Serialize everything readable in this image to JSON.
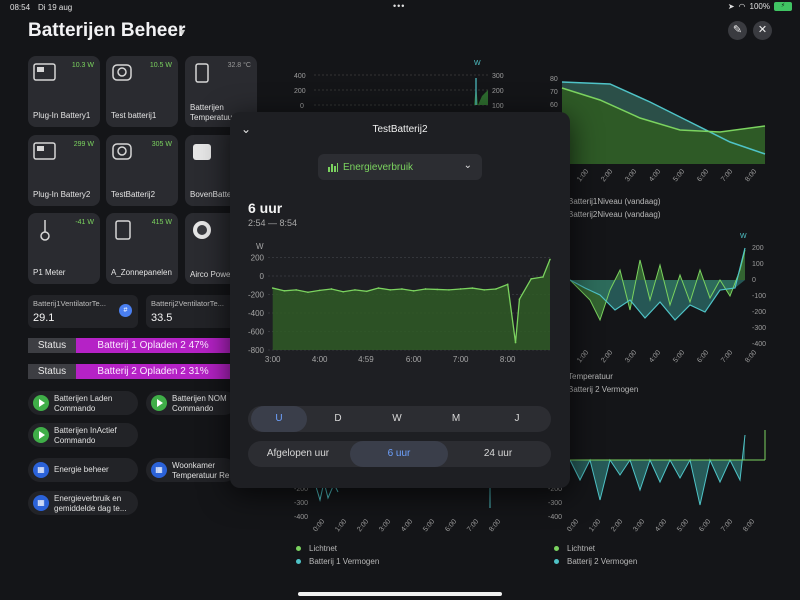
{
  "status_bar": {
    "time": "08:54",
    "date": "Di 19 aug",
    "battery": "100%"
  },
  "header": {
    "title": "Batterijen Beheer"
  },
  "tiles": [
    {
      "label": "Plug-In Battery1",
      "power": "10.3 W"
    },
    {
      "label": "Test batterij1",
      "power": "10.5 W"
    },
    {
      "label": "Batterijen Temperatuur",
      "power": "32.8 °C"
    },
    {
      "label": "Plug-In Battery2",
      "power": "299 W"
    },
    {
      "label": "TestBatterij2",
      "power": "305 W"
    },
    {
      "label": "BovenBatte",
      "power": "3"
    },
    {
      "label": "P1 Meter",
      "power": "-41 W"
    },
    {
      "label": "A_Zonnepanelen",
      "power": "415 W"
    },
    {
      "label": "Airco Power Plug",
      "power": ""
    }
  ],
  "sensors": [
    {
      "name": "Batterij1VentilatorTe...",
      "value": "29.1",
      "badge": "#"
    },
    {
      "name": "Batterij2VentilatorTe...",
      "value": "33.5"
    }
  ],
  "statuses": [
    {
      "key": "Status",
      "value": "Batterij 1 Opladen 2 47%"
    },
    {
      "key": "Status",
      "value": "Batterij 2 Opladen 2 31%"
    }
  ],
  "actions": [
    {
      "label": "Batterijen Laden Commando",
      "icon": "play-icon"
    },
    {
      "label": "Batterijen NOM Commando",
      "icon": "play-icon"
    },
    {
      "label": "Batterijen InActief Commando",
      "icon": "play-icon"
    },
    {
      "label": "Energie beheer",
      "icon": "grid-icon"
    },
    {
      "label": "Woonkamer Temperatuur Re",
      "icon": "grid-icon"
    },
    {
      "label": "Energieverbruik en gemiddelde dag te...",
      "icon": "grid-icon"
    }
  ],
  "bg_charts": {
    "top_left_unit": "W",
    "top_left_yleft": [
      "400",
      "200",
      "0"
    ],
    "top_left_yright": [
      "300",
      "200",
      "100"
    ],
    "top_right_yleft": [
      "80",
      "70",
      "60",
      "50"
    ],
    "top_right_xticks": [
      "1:00",
      "2:00",
      "3:00",
      "4:00",
      "5:00",
      "6:00",
      "7:00",
      "8:00"
    ],
    "top_right_legend": [
      "Batterij1Niveau (vandaag)",
      "Batterij2Niveau (vandaag)"
    ],
    "mid_right_unit": "W",
    "mid_right_yright": [
      "200",
      "100",
      "0",
      "-100",
      "-200",
      "-300",
      "-400"
    ],
    "mid_right_xticks": [
      "1:00",
      "2:00",
      "3:00",
      "4:00",
      "5:00",
      "6:00",
      "7:00",
      "8:00"
    ],
    "mid_right_legend": [
      "Temperatuur",
      "Batterij 2 Vermogen"
    ],
    "bottom_left_yleft": [
      "-200",
      "-300",
      "-400"
    ],
    "bottom_xticks": [
      "0:00",
      "1:00",
      "2:00",
      "3:00",
      "4:00",
      "5:00",
      "6:00",
      "7:00",
      "8:00"
    ],
    "bottom_right_yleft": [
      "-200",
      "-300",
      "-400"
    ],
    "bottom_left_legend": [
      "Lichtnet",
      "Batterij 1 Vermogen"
    ],
    "bottom_right_legend": [
      "Lichtnet",
      "Batterij 2 Vermogen"
    ]
  },
  "modal": {
    "title": "TestBatterij2",
    "dropdown": "Energieverbruik",
    "period_big": "6 uur",
    "period_range": "2:54 — 8:54",
    "chart_unit": "W",
    "yticks": [
      "200",
      "0",
      "-200",
      "-400",
      "-600",
      "-800"
    ],
    "xticks": [
      "3:00",
      "4:00",
      "4:59",
      "6:00",
      "7:00",
      "8:00"
    ],
    "granularity": [
      "U",
      "D",
      "W",
      "M",
      "J"
    ],
    "ranges": [
      "Afgelopen uur",
      "6 uur",
      "24 uur"
    ]
  },
  "colors": {
    "accent_green": "#7bd35f",
    "teal": "#4fc3c7",
    "status_magenta": "#b522c6",
    "active_blue": "#6ea2ff"
  },
  "chart_data": {
    "type": "line",
    "title": "",
    "ylabel": "W",
    "ylim": [
      -800,
      260
    ],
    "x": [
      "3:00",
      "3:15",
      "3:30",
      "3:45",
      "4:00",
      "4:15",
      "4:30",
      "4:45",
      "5:00",
      "5:15",
      "5:30",
      "5:45",
      "6:00",
      "6:15",
      "6:30",
      "6:45",
      "7:00",
      "7:15",
      "7:30",
      "7:45",
      "8:00",
      "8:10",
      "8:15",
      "8:30",
      "8:45",
      "8:54"
    ],
    "series": [
      {
        "values": [
          -130,
          -160,
          -150,
          -175,
          -155,
          -140,
          -170,
          -150,
          -165,
          -130,
          -150,
          -140,
          -160,
          -140,
          -145,
          -150,
          -140,
          -130,
          -150,
          -140,
          -90,
          -720,
          -250,
          -30,
          -10,
          180
        ]
      }
    ]
  }
}
